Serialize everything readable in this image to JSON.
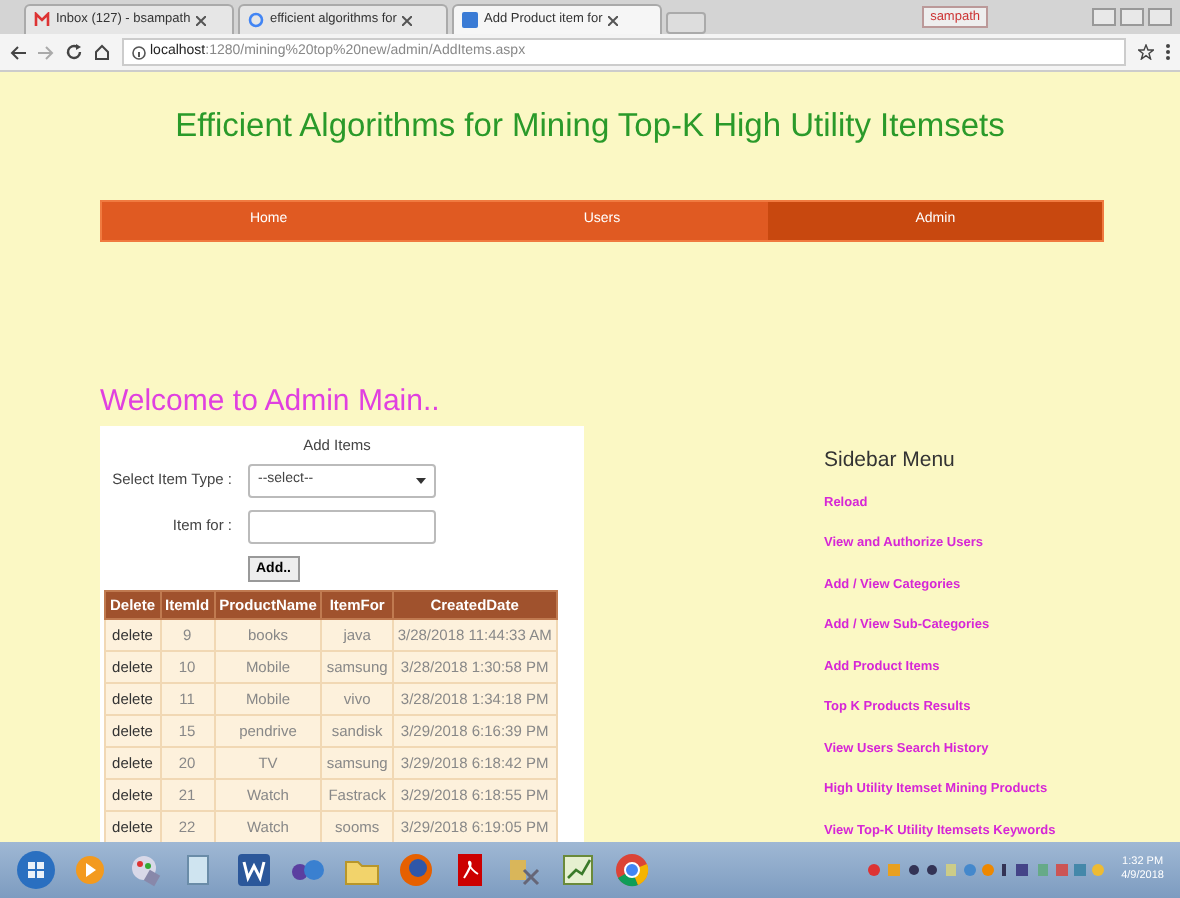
{
  "browser": {
    "tabs": [
      {
        "title": "Inbox (127) - bsampath",
        "selected": false
      },
      {
        "title": "efficient algorithms for",
        "selected": false
      },
      {
        "title": "Add Product item for",
        "selected": true
      }
    ],
    "user": "sampath",
    "url_host": "localhost",
    "url_path": ":1280/mining%20top%20new/admin/AddItems.aspx"
  },
  "page": {
    "title": "Efficient Algorithms for Mining Top-K High Utility Itemsets",
    "nav": [
      {
        "label": "Home",
        "selected": false
      },
      {
        "label": "Users",
        "selected": false
      },
      {
        "label": "Admin",
        "selected": true
      }
    ],
    "welcome": "Welcome to Admin Main..",
    "form": {
      "title": "Add Items",
      "type_label": "Select Item Type :",
      "type_value": "--select--",
      "for_label": "Item for :",
      "button": "Add.."
    },
    "table": {
      "columns": [
        "Delete",
        "ItemId",
        "ProductName",
        "ItemFor",
        "CreatedDate"
      ],
      "rows": [
        [
          "delete",
          "9",
          "books",
          "java",
          "3/28/2018 11:44:33 AM"
        ],
        [
          "delete",
          "10",
          "Mobile",
          "samsung",
          "3/28/2018 1:30:58 PM"
        ],
        [
          "delete",
          "11",
          "Mobile",
          "vivo",
          "3/28/2018 1:34:18 PM"
        ],
        [
          "delete",
          "15",
          "pendrive",
          "sandisk",
          "3/29/2018 6:16:39 PM"
        ],
        [
          "delete",
          "20",
          "TV",
          "samsung",
          "3/29/2018 6:18:42 PM"
        ],
        [
          "delete",
          "21",
          "Watch",
          "Fastrack",
          "3/29/2018 6:18:55 PM"
        ],
        [
          "delete",
          "22",
          "Watch",
          "sooms",
          "3/29/2018 6:19:05 PM"
        ]
      ]
    },
    "sidebar": {
      "title": "Sidebar Menu",
      "items": [
        "Reload",
        "View and Authorize Users",
        "Add / View Categories",
        "Add / View Sub-Categories",
        "Add Product Items",
        "Top K Products Results",
        "View Users  Search History",
        "High Utility Itemset Mining Products",
        "View Top-K Utility Itemsets Keywords"
      ]
    }
  },
  "taskbar": {
    "time": "1:32 PM",
    "date": "4/9/2018"
  }
}
